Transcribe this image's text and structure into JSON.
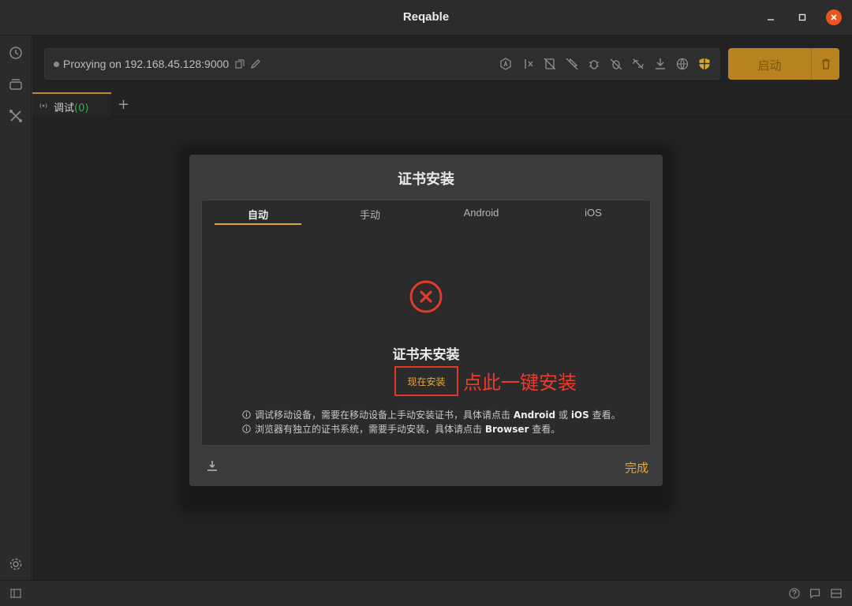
{
  "window": {
    "title": "Reqable"
  },
  "proxy": {
    "status_text": "Proxying on 192.168.45.128:9000"
  },
  "start_button": {
    "label": "启动"
  },
  "tabs": [
    {
      "label": "调试",
      "count": "(0)"
    }
  ],
  "dialog": {
    "title": "证书安装",
    "tabs": [
      "自动",
      "手动",
      "Android",
      "iOS"
    ],
    "active_tab": "自动",
    "status": "证书未安装",
    "install_button": "现在安装",
    "annotation": "点此一键安装",
    "notes": [
      {
        "before": "调试移动设备，需要在移动设备上手动安装证书，具体请点击",
        "b1": "Android",
        "mid": "或",
        "b2": "iOS",
        "after": "查看。"
      },
      {
        "before": "浏览器有独立的证书系统，需要手动安装，具体请点击",
        "b1": "Browser",
        "after": "查看。"
      }
    ],
    "done_button": "完成"
  },
  "colors": {
    "accent": "#e0a23a",
    "start_bg": "#b8831f",
    "error": "#e23b2b",
    "close": "#e95420"
  }
}
